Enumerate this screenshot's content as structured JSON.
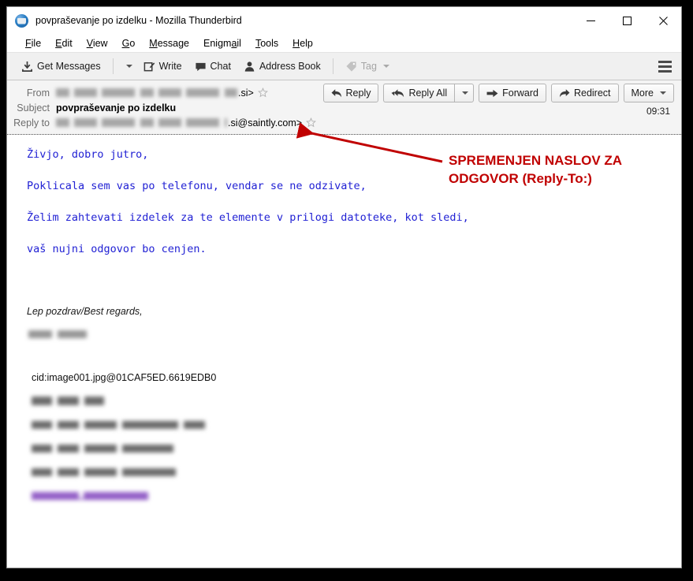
{
  "window": {
    "title": "povpraševanje po izdelku - Mozilla Thunderbird",
    "app_icon": "thunderbird-icon",
    "controls": {
      "minimize": "minimize-icon",
      "maximize": "maximize-icon",
      "close": "close-icon"
    }
  },
  "menu": {
    "items": [
      {
        "label": "File",
        "accel": "F"
      },
      {
        "label": "Edit",
        "accel": "E"
      },
      {
        "label": "View",
        "accel": "V"
      },
      {
        "label": "Go",
        "accel": "G"
      },
      {
        "label": "Message",
        "accel": "M"
      },
      {
        "label": "Enigmail",
        "accel": "a"
      },
      {
        "label": "Tools",
        "accel": "T"
      },
      {
        "label": "Help",
        "accel": "H"
      }
    ]
  },
  "toolbar": {
    "get_messages": "Get Messages",
    "write": "Write",
    "chat": "Chat",
    "address_book": "Address Book",
    "tag": "Tag",
    "tag_disabled": true,
    "menu_button": "app-menu-icon"
  },
  "header_actions": {
    "reply": "Reply",
    "reply_all": "Reply All",
    "forward": "Forward",
    "redirect": "Redirect",
    "more": "More"
  },
  "message": {
    "timestamp": "09:31",
    "fields": [
      {
        "label": "From",
        "redacted": true,
        "prefix": "",
        "visible_suffix": ".si>",
        "starred": false,
        "star_icon": "star-outline-icon"
      },
      {
        "label": "Subject",
        "redacted": false,
        "value": "povpraševanje po izdelku",
        "bold": true
      },
      {
        "label": "Reply to",
        "redacted": true,
        "prefix": "",
        "visible_suffix": ".si@saintly.com>",
        "starred": false,
        "star_icon": "star-outline-icon"
      }
    ],
    "body_lines": [
      "Živjo, dobro jutro,",
      "Poklicala sem vas po telefonu, vendar se ne odzivate,",
      "Želim zahtevati izdelek za te elemente v prilogi datoteke, kot sledi,",
      "vaš nujni odgovor bo cenjen."
    ],
    "body_color": "#2121d4",
    "signature": {
      "regards": "Lep pozdrav/Best regards,",
      "name_redacted": true,
      "cid_line": "cid:image001.jpg@01CAF5ED.6619EDB0",
      "footer_redacted_rows": 5,
      "footer_link_color": "#8246be"
    }
  },
  "annotation": {
    "line1": "SPREMENJEN NASLOV ZA",
    "line2": "ODGOVOR (Reply-To:)",
    "color": "#c00000",
    "arrow": "red-arrow-pointer"
  }
}
